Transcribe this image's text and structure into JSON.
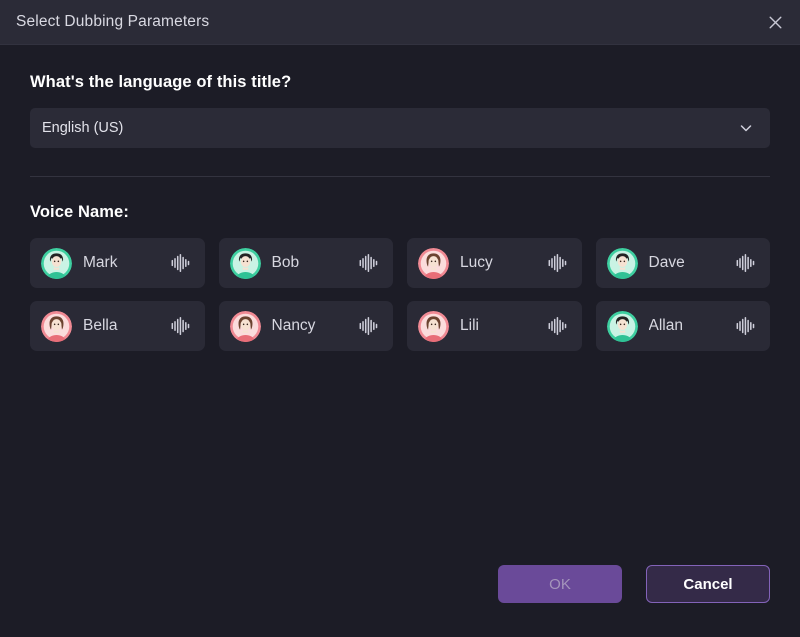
{
  "window": {
    "title": "Select Dubbing Parameters",
    "close_icon": "close-icon"
  },
  "language_section": {
    "label": "What's the language of this title?",
    "selected_value": "English (US)",
    "chevron_icon": "chevron-down-icon"
  },
  "voice_section": {
    "label": "Voice Name:",
    "voices": [
      {
        "name": "Mark",
        "avatar_color": "#3ecfa0",
        "gender": "male",
        "wave_icon": "waveform-icon"
      },
      {
        "name": "Bob",
        "avatar_color": "#3ecfa0",
        "gender": "male",
        "wave_icon": "waveform-icon"
      },
      {
        "name": "Lucy",
        "avatar_color": "#f08a94",
        "gender": "female",
        "wave_icon": "waveform-icon"
      },
      {
        "name": "Dave",
        "avatar_color": "#3ecfa0",
        "gender": "male",
        "wave_icon": "waveform-icon"
      },
      {
        "name": "Bella",
        "avatar_color": "#f08a94",
        "gender": "female",
        "wave_icon": "waveform-icon"
      },
      {
        "name": "Nancy",
        "avatar_color": "#f08a94",
        "gender": "female",
        "wave_icon": "waveform-icon"
      },
      {
        "name": "Lili",
        "avatar_color": "#f08a94",
        "gender": "female",
        "wave_icon": "waveform-icon"
      },
      {
        "name": "Allan",
        "avatar_color": "#3ecfa0",
        "gender": "male",
        "wave_icon": "waveform-icon"
      }
    ]
  },
  "footer": {
    "ok_label": "OK",
    "cancel_label": "Cancel"
  },
  "colors": {
    "background": "#1c1c26",
    "titlebar": "#2b2b37",
    "card": "#2a2a36",
    "field": "#2b2b37",
    "accent_purple": "#6a4a99",
    "cancel_fill": "#342a48",
    "cancel_border": "#8363b9",
    "avatar_green": "#3ecfa0",
    "avatar_pink": "#f08a94"
  }
}
